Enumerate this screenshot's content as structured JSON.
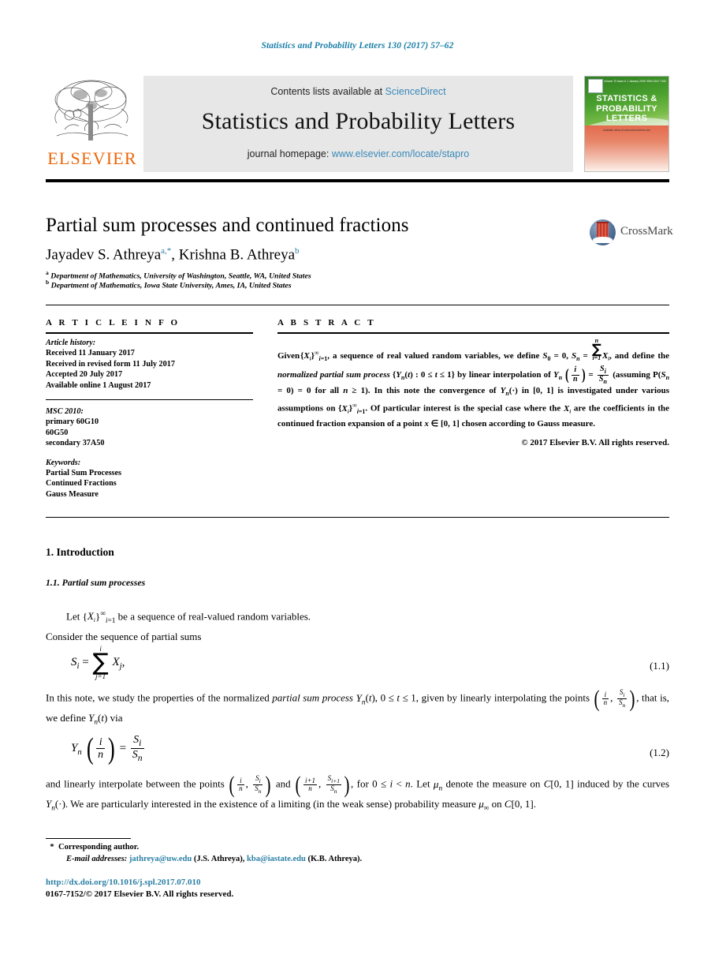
{
  "running_head": "Statistics and Probability Letters 130 (2017) 57–62",
  "masthead": {
    "contents_prefix": "Contents lists available at ",
    "contents_link": "ScienceDirect",
    "journal_title": "Statistics and Probability Letters",
    "homepage_prefix": "journal homepage: ",
    "homepage_link": "www.elsevier.com/locate/stapro",
    "publisher_wordmark": "ELSEVIER",
    "cover": {
      "title_line1": "STATISTICS &",
      "title_line2": "PROBABILITY",
      "title_line3": "LETTERS",
      "issue_left": "Volume 70 Issue 6",
      "issue_mid": "1 January 2005",
      "issue_right": "ISSN 0167-7152",
      "caption": "Available online at www.sciencedirect.com"
    }
  },
  "article": {
    "title": "Partial sum processes and continued fractions",
    "authors": "Jayadev S. Athreya, Krishna B. Athreya",
    "author1_name": "Jayadev S. Athreya",
    "author1_marks": "a,*",
    "author2_name": "Krishna B. Athreya",
    "author2_marks": "b",
    "affiliation_a_mark": "a",
    "affiliation_a": "Department of Mathematics, University of Washington, Seattle, WA, United States",
    "affiliation_b_mark": "b",
    "affiliation_b": "Department of Mathematics, Iowa State University, Ames, IA, United States",
    "crossmark_label": "CrossMark"
  },
  "info": {
    "heading": "A R T I C L E    I N F O",
    "history_label": "Article history:",
    "history": [
      "Received 11 January 2017",
      "Received in revised form 11 July 2017",
      "Accepted 20 July 2017",
      "Available online 1 August 2017"
    ],
    "msc_label": "MSC 2010:",
    "msc": [
      "primary 60G10",
      "60G50",
      "secondary 37A50"
    ],
    "keywords_label": "Keywords:",
    "keywords": [
      "Partial Sum Processes",
      "Continued Fractions",
      "Gauss Measure"
    ]
  },
  "abstract": {
    "heading": "A B S T R A C T",
    "line1_a": "Given",
    "line1_b": ", a sequence of real valued random variables, we define",
    "text_seg1": "Given {X",
    "copyright": "© 2017 Elsevier B.V. All rights reserved.",
    "p1": "Given {Xi}∞i=1, a sequence of real valued random variables, we define S0 = 0, Sn = Σni=1Xi, and define the normalized partial sum process {Yn(t) : 0 ≤ t ≤ 1} by linear interpolation of Yn(i/n) = Si/Sn (assuming P(Sn = 0) = 0 for all n ≥ 1). In this note the convergence of Yn(·) in [0, 1] is investigated under various assumptions on {Xi}∞i=1. Of particular interest is the special case where the Xi are the coefficients in the continued fraction expansion of a point x ∈ [0, 1] chosen according to Gauss measure."
  },
  "body": {
    "section1_number": "1.",
    "section1_title": "Introduction",
    "section11_number": "1.1.",
    "section11_title": "Partial sum processes",
    "para1_lead": "Let {X",
    "para1_rest": " be a sequence of real-valued random variables.",
    "para1_line2": "Consider the sequence of partial sums",
    "eq11_number": "(1.1)",
    "eq12_number": "(1.2)",
    "para2": "In this note, we study the properties of the normalized partial sum process Yn(t), 0 ≤ t ≤ 1, given by linearly interpolating the points (i/n, Si/Sn), that is, we define Yn(t) via",
    "para3": "and linearly interpolate between the points (i/n, Si/Sn) and ((i+1)/n, Si+1/Sn), for 0 ≤ i < n. Let μn denote the measure on C[0, 1] induced by the curves Yn(·). We are particularly interested in the existence of a limiting (in the weak sense) probability measure μ∞ on C[0, 1]."
  },
  "footer": {
    "corresponding_mark": "*",
    "corresponding_text": "Corresponding author.",
    "email_label": "E-mail addresses:",
    "email1": "jathreya@uw.edu",
    "email1_owner": "(J.S. Athreya),",
    "email2": "kba@iastate.edu",
    "email2_owner": "(K.B. Athreya).",
    "doi": "http://dx.doi.org/10.1016/j.spl.2017.07.010",
    "issn": "0167-7152/© 2017 Elsevier B.V. All rights reserved."
  },
  "colors": {
    "link": "#2b7fa5",
    "running_head": "#1b7fa8",
    "elsevier_orange": "#eb6608",
    "masthead_bg": "#e7e7e7"
  }
}
